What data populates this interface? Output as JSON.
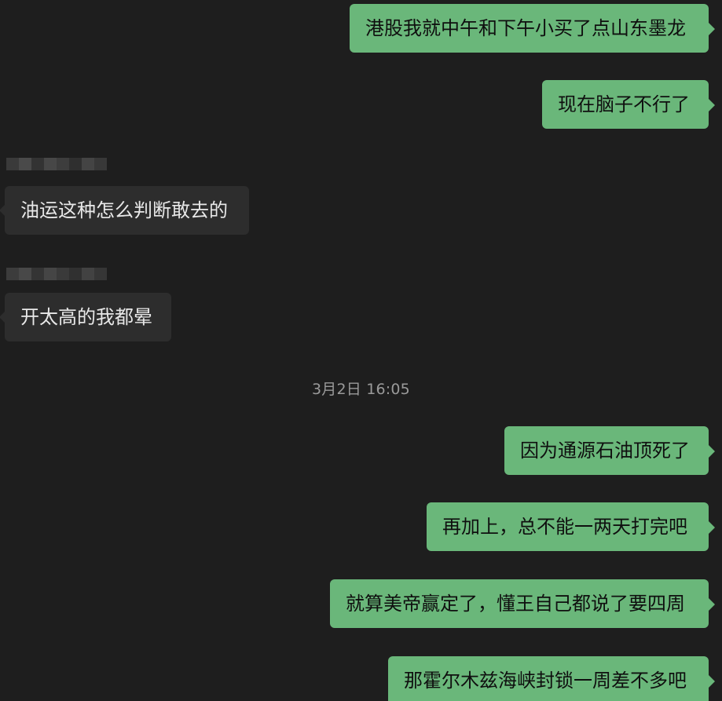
{
  "chat": {
    "messages": [
      {
        "side": "sent",
        "text": "港股我就中午和下午小买了点山东墨龙"
      },
      {
        "side": "sent",
        "text": "现在脑子不行了"
      },
      {
        "side": "received",
        "text": "油运这种怎么判断敢去的"
      },
      {
        "side": "received",
        "text": "开太高的我都晕"
      },
      {
        "side": "sent",
        "text": "因为通源石油顶死了"
      },
      {
        "side": "sent",
        "text": "再加上，总不能一两天打完吧"
      },
      {
        "side": "sent",
        "text": "就算美帝赢定了，懂王自己都说了要四周"
      },
      {
        "side": "sent",
        "text": "那霍尔木兹海峡封锁一周差不多吧"
      }
    ],
    "timestamp": "3月2日 16:05"
  },
  "colors": {
    "background": "#1e1e1e",
    "sent_bubble": "#6ab77a",
    "received_bubble": "#2d2d2d",
    "timestamp_text": "#9a9a9a"
  }
}
